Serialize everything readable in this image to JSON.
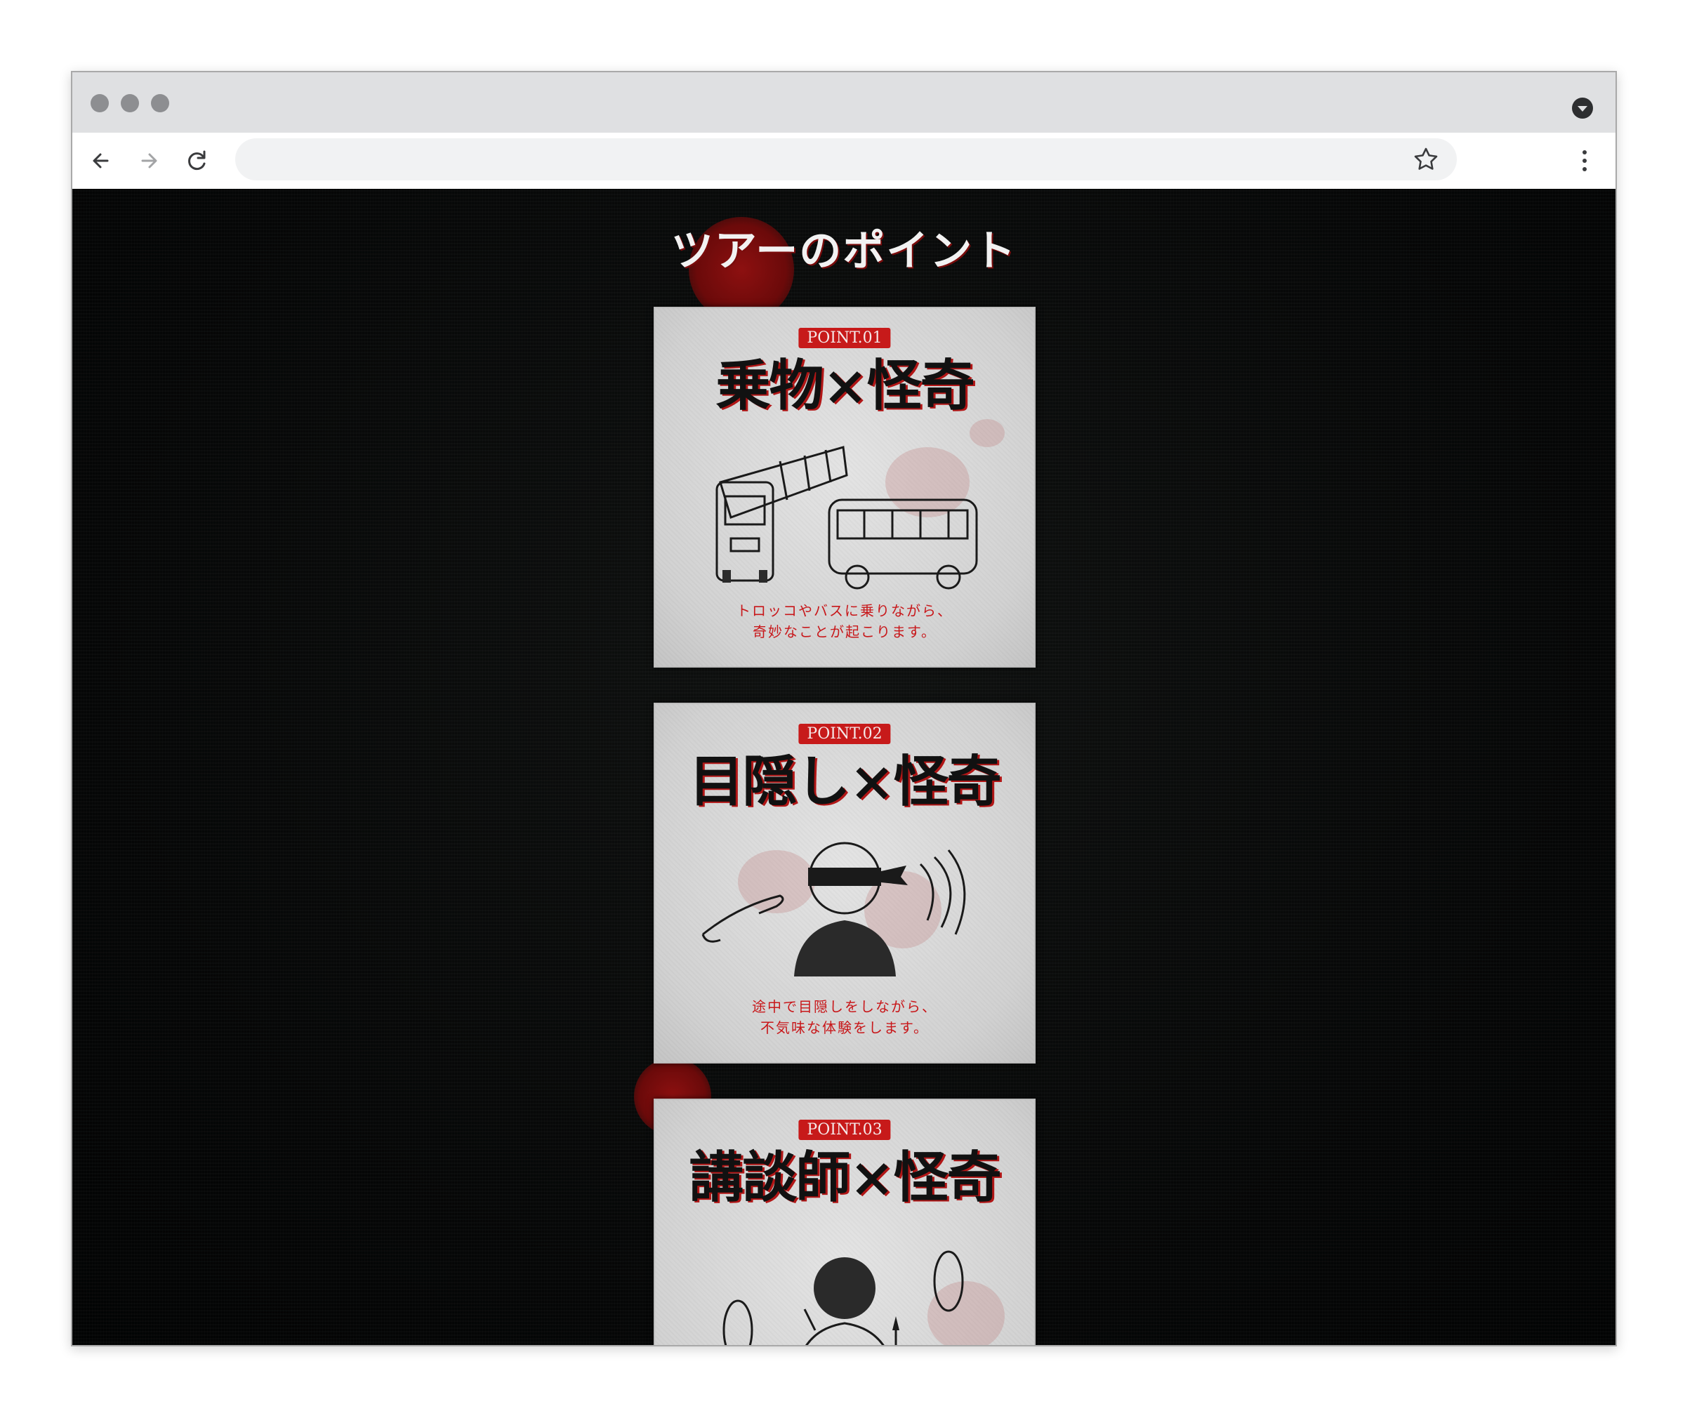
{
  "browser": {
    "address": "",
    "icons": [
      "back-arrow-icon",
      "forward-arrow-icon",
      "reload-icon",
      "star-icon",
      "kebab-menu-icon",
      "tab-menu-icon"
    ]
  },
  "page": {
    "section_title": "ツアーのポイント",
    "points": [
      {
        "badge": "POINT.01",
        "title": "乗物×怪奇",
        "description": "トロッコやバスに乗りながら、\n奇妙なことが起こります。",
        "illustration": "train-and-bus-illustration"
      },
      {
        "badge": "POINT.02",
        "title": "目隠し×怪奇",
        "description": "途中で目隠しをしながら、\n不気味な体験をします。",
        "illustration": "blindfolded-person-illustration"
      },
      {
        "badge": "POINT.03",
        "title": "講談師×怪奇",
        "description": "",
        "illustration": "storyteller-illustration"
      }
    ]
  },
  "colors": {
    "page_bg": "#050606",
    "card_bg": "#d9d9d9",
    "accent_red": "#c71a1a",
    "title_text": "#f2f2f2"
  }
}
